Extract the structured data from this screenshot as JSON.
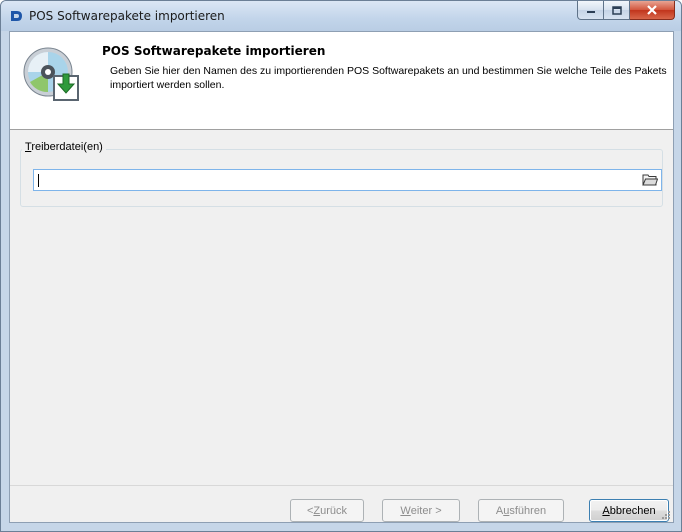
{
  "window": {
    "title": "POS Softwarepakete importieren"
  },
  "header": {
    "title": "POS Softwarepakete importieren",
    "description": "Geben Sie hier den Namen des zu importierenden POS Softwarepakets an und bestimmen Sie welche Teile des Pakets importiert werden sollen.",
    "icon": "cd-import-icon"
  },
  "driver_group": {
    "label_accel": "T",
    "label_rest": "reiberdatei(en)",
    "file_value": "",
    "browse_icon": "open-folder-icon"
  },
  "buttons": {
    "back": {
      "accel_prefix": "< ",
      "accel": "Z",
      "rest": "urück"
    },
    "next": {
      "accel": "W",
      "rest": "eiter >"
    },
    "execute": {
      "prefix": "A",
      "accel": "u",
      "rest": "sführen"
    },
    "cancel": {
      "accel": "A",
      "rest": "bbrechen"
    }
  },
  "colors": {
    "accent": "#3c7fb1",
    "title_bar": "#c2d5ea",
    "close_button": "#c1351c"
  }
}
